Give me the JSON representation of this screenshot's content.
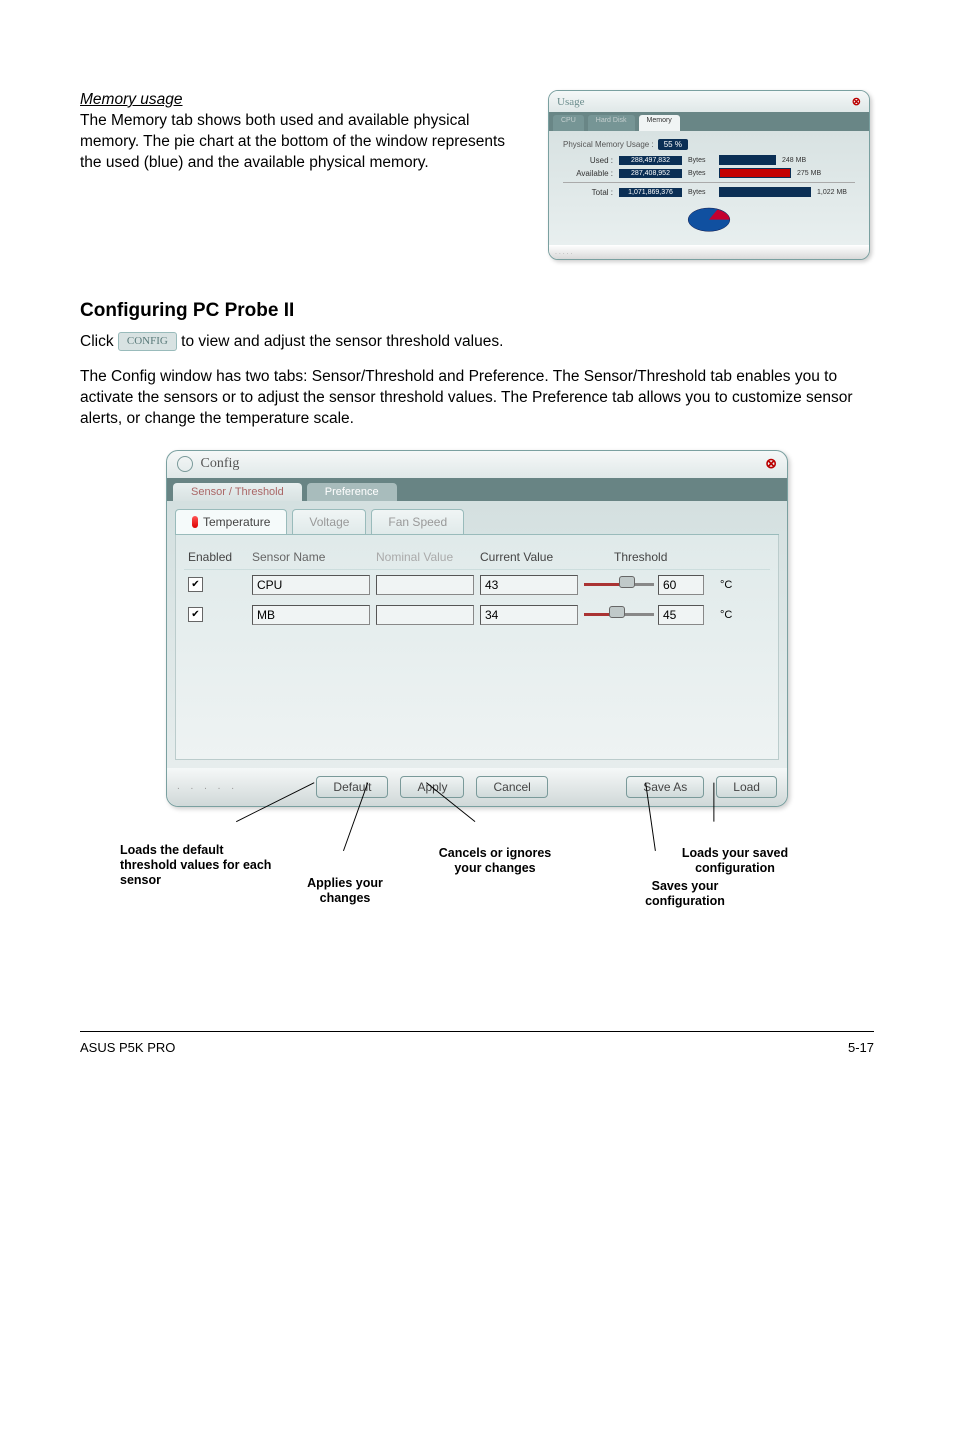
{
  "memory_section": {
    "heading": "Memory usage",
    "body": "The Memory tab shows both used and available physical memory. The pie chart at the bottom of the window represents the used (blue) and the available physical memory.",
    "window": {
      "title": "Usage",
      "tabs": [
        "CPU",
        "Hard Disk",
        "Memory"
      ],
      "header": "Physical Memory Usage :",
      "header_pct": "55 %",
      "rows": [
        {
          "label": "Used :",
          "value": "288,497,832",
          "unit": "Bytes",
          "mb": "248 MB"
        },
        {
          "label": "Available :",
          "value": "287,408,952",
          "unit": "Bytes",
          "mb": "275 MB"
        },
        {
          "label": "Total :",
          "value": "1,071,869,376",
          "unit": "Bytes",
          "mb": "1,022 MB"
        }
      ]
    }
  },
  "config_section": {
    "title": "Configuring PC Probe II",
    "inline_button": "CONFIG",
    "para1_before": "Click ",
    "para1_after": " to view and adjust the sensor threshold values.",
    "para2": "The Config window has two tabs: Sensor/Threshold and Preference. The Sensor/Threshold tab enables you to activate the sensors or to adjust the sensor threshold values. The Preference tab allows you to customize sensor alerts, or change the temperature scale.",
    "window": {
      "title": "Config",
      "outer_tabs": [
        {
          "label": "Sensor / Threshold",
          "active": true
        },
        {
          "label": "Preference",
          "active": false
        }
      ],
      "inner_tabs": [
        {
          "label": "Temperature",
          "active": true
        },
        {
          "label": "Voltage",
          "active": false
        },
        {
          "label": "Fan Speed",
          "active": false
        }
      ],
      "columns": {
        "c1": "Enabled",
        "c2": "Sensor Name",
        "c3": "Nominal Value",
        "c4": "Current Value",
        "c5": "Threshold"
      },
      "rows": [
        {
          "enabled": true,
          "name": "CPU",
          "nominal": "",
          "current": "43",
          "threshold": "60",
          "unit": "°C",
          "slider_pct": 55
        },
        {
          "enabled": true,
          "name": "MB",
          "nominal": "",
          "current": "34",
          "threshold": "45",
          "unit": "°C",
          "slider_pct": 40
        }
      ],
      "buttons": {
        "default": "Default",
        "apply": "Apply",
        "cancel": "Cancel",
        "saveas": "Save As",
        "load": "Load"
      }
    },
    "callouts": {
      "default": "Loads the default threshold values for each sensor",
      "apply": "Applies your changes",
      "cancel": "Cancels or ignores your changes",
      "saveas": "Saves your configuration",
      "load": "Loads your saved configuration"
    }
  },
  "footer": {
    "left": "ASUS P5K PRO",
    "right": "5-17"
  }
}
